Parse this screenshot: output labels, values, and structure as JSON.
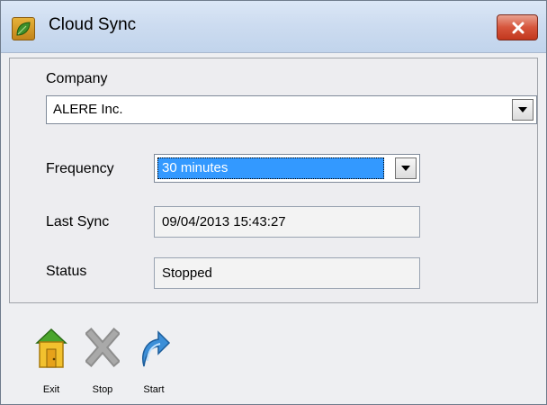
{
  "window": {
    "title": "Cloud Sync",
    "icon": "leaf-app-icon",
    "close_icon": "close-icon"
  },
  "form": {
    "company_label": "Company",
    "company_value": "ALERE Inc.",
    "frequency_label": "Frequency",
    "frequency_value": "30 minutes",
    "last_sync_label": "Last Sync",
    "last_sync_value": "09/04/2013 15:43:27",
    "status_label": "Status",
    "status_value": "Stopped"
  },
  "toolbar": {
    "exit_label": "Exit",
    "stop_label": "Stop",
    "start_label": "Start"
  },
  "colors": {
    "selection": "#3399ff",
    "close_button": "#c9452b",
    "titlebar": "#cddcf0"
  }
}
